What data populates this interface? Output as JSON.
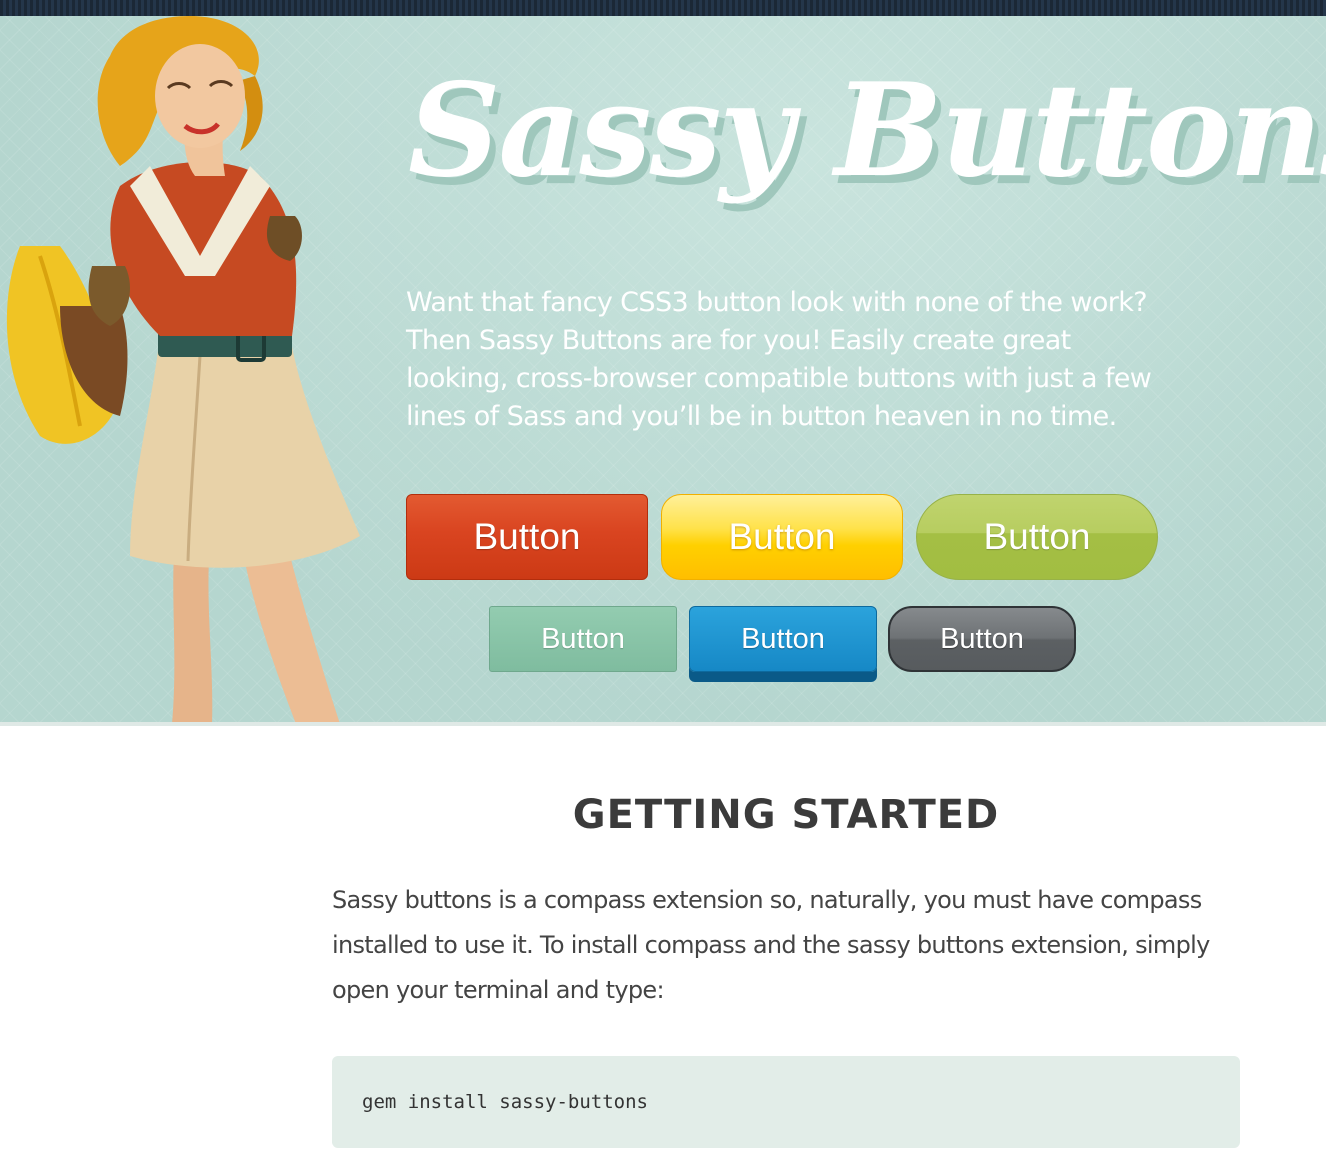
{
  "hero": {
    "title": "Sassy Buttons",
    "tagline": "Want that fancy CSS3 button look with none of the work? Then Sassy Buttons are for you! Easily create great looking, cross-browser compatible buttons with just a few lines of Sass and you’ll be in button heaven in no time.",
    "illustration": "pin-up-girl-illustration"
  },
  "buttons": {
    "red": "Button",
    "yellow": "Button",
    "green": "Button",
    "mint": "Button",
    "blue": "Button",
    "grey": "Button"
  },
  "getting_started": {
    "heading": "GETTING STARTED",
    "body": "Sassy buttons is a compass extension so, naturally, you must have compass installed to use it. To install compass and the sassy buttons extension, simply open your terminal and type:",
    "code": "gem install sassy-buttons"
  },
  "colors": {
    "hero_background": "#b5d6cf",
    "red_button": "#d94420",
    "yellow_button": "#ffd000",
    "green_button": "#a4bf44",
    "mint_button": "#7fbc9f",
    "blue_button": "#1688c6",
    "grey_button": "#6e7275",
    "code_background": "#e2ede8"
  }
}
